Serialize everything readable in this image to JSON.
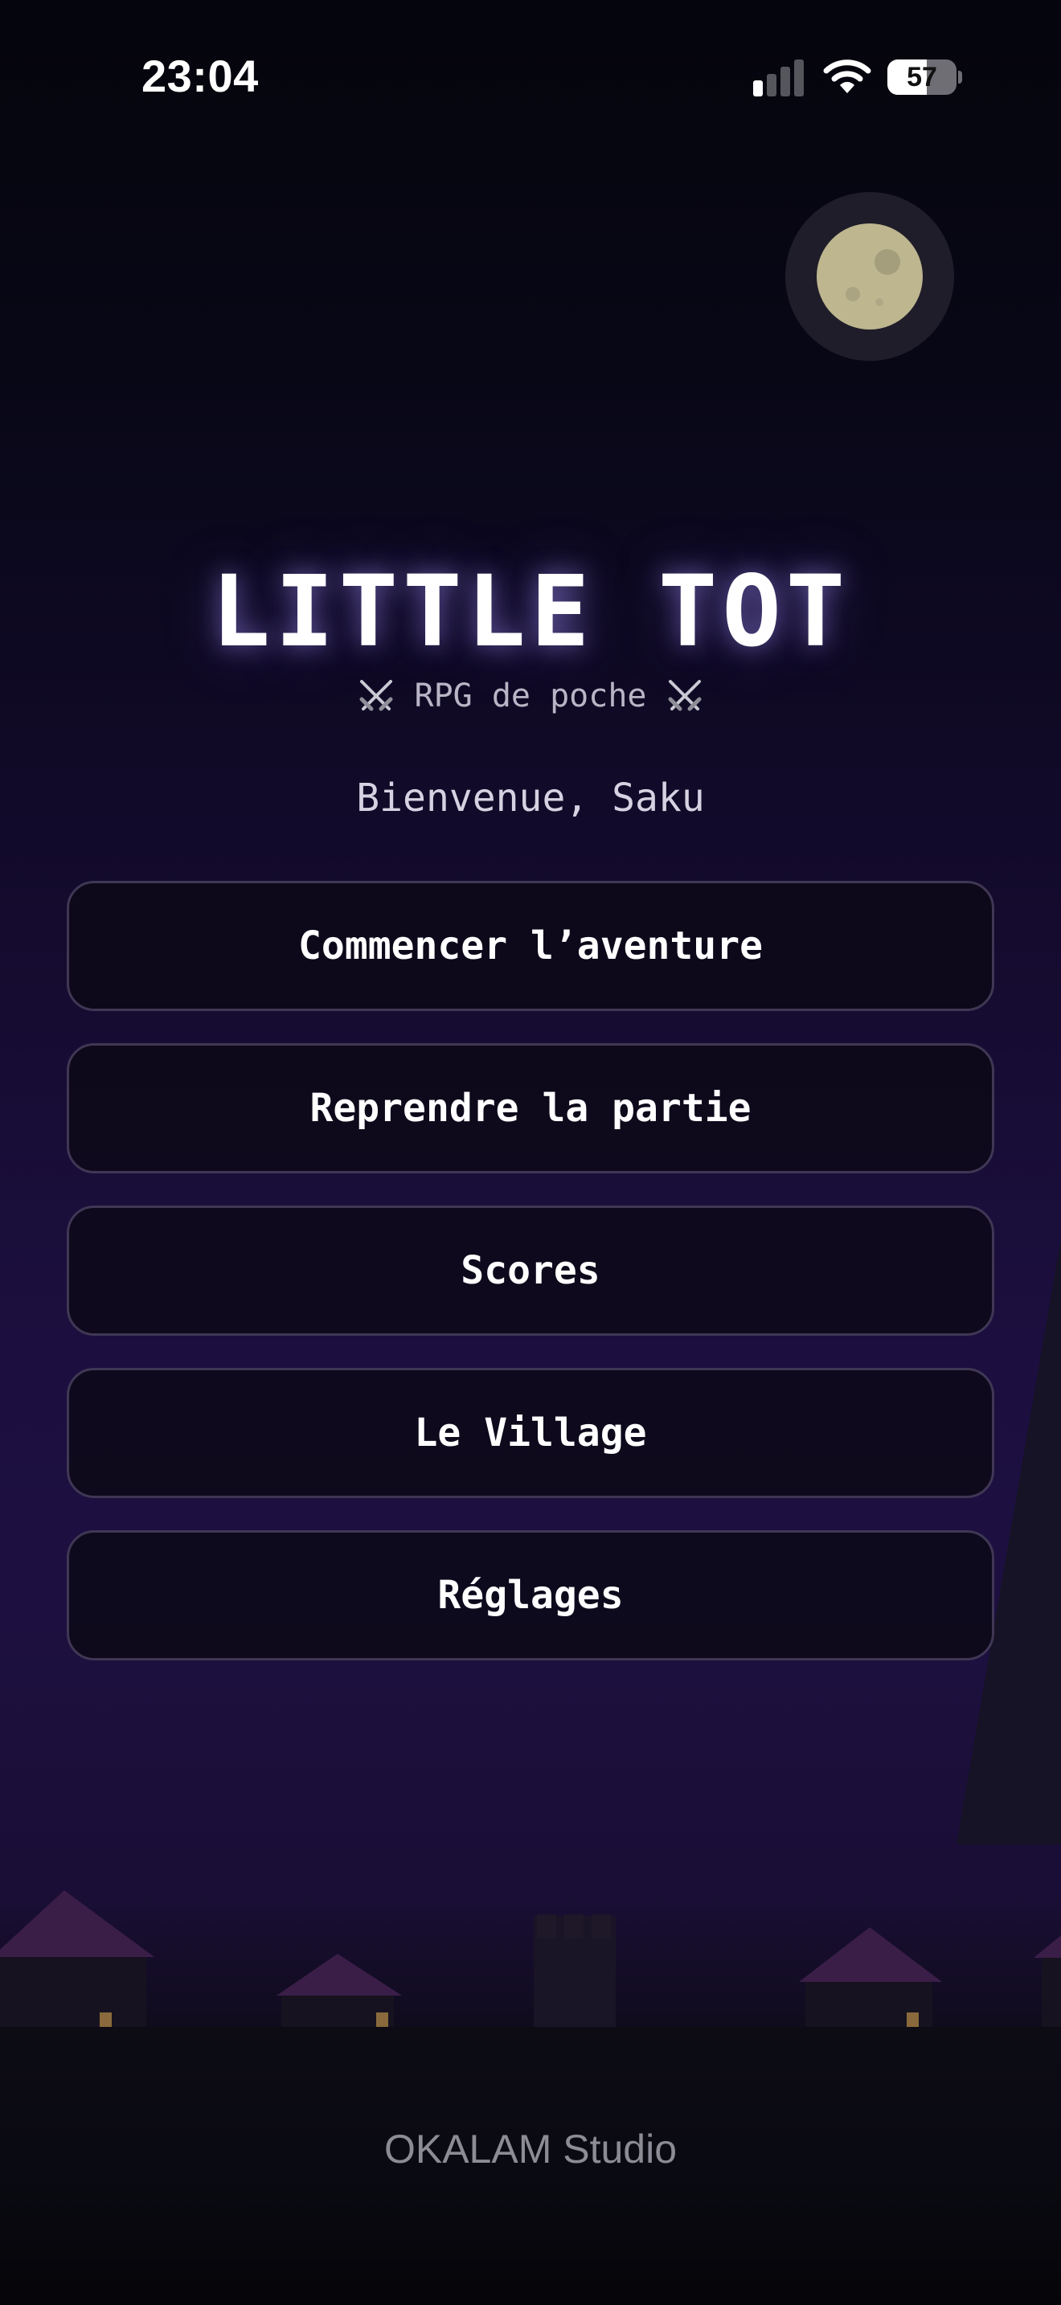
{
  "status_bar": {
    "time": "23:04",
    "battery_percent": "57",
    "battery_level": 0.57,
    "signal_icon": "signal-bars-icon",
    "wifi_icon": "wifi-icon"
  },
  "title": {
    "main": "LITTLE TOT",
    "subtitle": "RPG de poche",
    "decoration_icon": "crossed-swords-icon"
  },
  "welcome": "Bienvenue, Saku",
  "menu": {
    "items": [
      {
        "label": "Commencer l’aventure"
      },
      {
        "label": "Reprendre la partie"
      },
      {
        "label": "Scores"
      },
      {
        "label": "Le Village"
      },
      {
        "label": "Réglages"
      }
    ]
  },
  "footer": {
    "studio": "OKALAM Studio"
  },
  "colors": {
    "button_border": "#3f3754",
    "button_bg": "#0c0916",
    "moon": "#bdb68f",
    "roof": "#3a1e48",
    "window_light": "#8a6a3c"
  }
}
